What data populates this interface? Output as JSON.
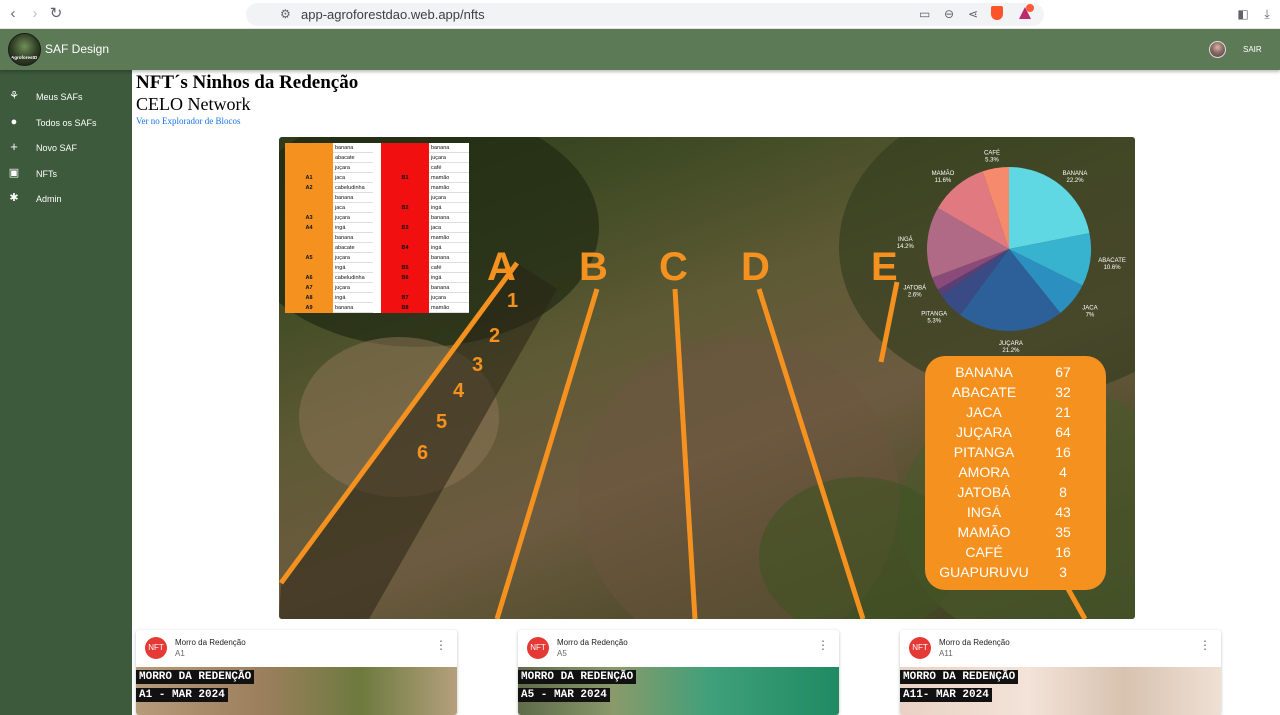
{
  "browser": {
    "url": "app-agroforestdao.web.app/nfts",
    "back_icon": "arrow-left-icon",
    "forward_icon": "arrow-right-icon",
    "reload_icon": "reload-icon"
  },
  "appbar": {
    "logo_text": "AgroforestDAO",
    "title": "SAF Design",
    "logout_label": "SAIR"
  },
  "sidebar": {
    "items": [
      {
        "label": "Meus SAFs",
        "icon": "seedling-icon"
      },
      {
        "label": "Todos os SAFs",
        "icon": "globe-icon"
      },
      {
        "label": "Novo SAF",
        "icon": "plus-icon"
      },
      {
        "label": "NFTs",
        "icon": "image-icon"
      },
      {
        "label": "Admin",
        "icon": "gear-icon"
      }
    ]
  },
  "main": {
    "title": "NFT´s Ninhos da Redenção",
    "subtitle": "CELO Network",
    "explorer_link": "Ver no Explorador de Blocos"
  },
  "hero": {
    "table_left": [
      {
        "id": "",
        "plant": "banana"
      },
      {
        "id": "",
        "plant": "abacate"
      },
      {
        "id": "",
        "plant": "juçara"
      },
      {
        "id": "A1",
        "plant": "jaca"
      },
      {
        "id": "A2",
        "plant": "cabeludinha"
      },
      {
        "id": "",
        "plant": "banana"
      },
      {
        "id": "",
        "plant": "jaca"
      },
      {
        "id": "A3",
        "plant": "juçara"
      },
      {
        "id": "A4",
        "plant": "ingá"
      },
      {
        "id": "",
        "plant": "banana"
      },
      {
        "id": "",
        "plant": "abacate"
      },
      {
        "id": "A5",
        "plant": "juçara"
      },
      {
        "id": "",
        "plant": "ingá"
      },
      {
        "id": "A6",
        "plant": "cabeludinha"
      },
      {
        "id": "A7",
        "plant": "juçara"
      },
      {
        "id": "A8",
        "plant": "ingá"
      },
      {
        "id": "A9",
        "plant": "banana"
      }
    ],
    "table_right": [
      {
        "id": "",
        "plant": "banana"
      },
      {
        "id": "",
        "plant": "juçara"
      },
      {
        "id": "",
        "plant": "café"
      },
      {
        "id": "B1",
        "plant": "mamão"
      },
      {
        "id": "",
        "plant": "mamão"
      },
      {
        "id": "",
        "plant": "juçara"
      },
      {
        "id": "B2",
        "plant": "ingá"
      },
      {
        "id": "",
        "plant": "banana"
      },
      {
        "id": "B3",
        "plant": "jaca"
      },
      {
        "id": "",
        "plant": "mamão"
      },
      {
        "id": "B4",
        "plant": "ingá"
      },
      {
        "id": "",
        "plant": "banana"
      },
      {
        "id": "B5",
        "plant": "café"
      },
      {
        "id": "B6",
        "plant": "ingá"
      },
      {
        "id": "",
        "plant": "banana"
      },
      {
        "id": "B7",
        "plant": "juçara"
      },
      {
        "id": "B8",
        "plant": "mamão"
      }
    ],
    "row_letters": [
      "A",
      "B",
      "C",
      "D",
      "E"
    ],
    "row_numbers": [
      "1",
      "2",
      "3",
      "4",
      "5",
      "6"
    ],
    "species_counts": [
      {
        "name": "BANANA",
        "count": "67"
      },
      {
        "name": "ABACATE",
        "count": "32"
      },
      {
        "name": "JACA",
        "count": "21"
      },
      {
        "name": "JUÇARA",
        "count": "64"
      },
      {
        "name": "PITANGA",
        "count": "16"
      },
      {
        "name": "AMORA",
        "count": "4"
      },
      {
        "name": "JATOBÁ",
        "count": "8"
      },
      {
        "name": "INGÁ",
        "count": "43"
      },
      {
        "name": "MAMÃO",
        "count": "35"
      },
      {
        "name": "CAFÉ",
        "count": "16"
      },
      {
        "name": "GUAPURUVU",
        "count": "3"
      }
    ],
    "pie": [
      {
        "label": "BANANA",
        "pct": "22.2%",
        "value": 22.2,
        "color": "#5fd8e3"
      },
      {
        "label": "ABACATE",
        "pct": "10.6%",
        "value": 10.6,
        "color": "#37b3d0"
      },
      {
        "label": "JACA",
        "pct": "7%",
        "value": 7.0,
        "color": "#2b8fbf"
      },
      {
        "label": "JUÇARA",
        "pct": "21.2%",
        "value": 21.2,
        "color": "#2d5f98"
      },
      {
        "label": "PITANGA",
        "pct": "5.3%",
        "value": 5.3,
        "color": "#3a4a84"
      },
      {
        "label": "",
        "pct": "",
        "value": 1.4,
        "color": "#5a3f74"
      },
      {
        "label": "JATOBÁ",
        "pct": "2.6%",
        "value": 2.6,
        "color": "#8a4a7a"
      },
      {
        "label": "INGÁ",
        "pct": "14.2%",
        "value": 14.2,
        "color": "#b06a86"
      },
      {
        "label": "MAMÃO",
        "pct": "11.6%",
        "value": 11.6,
        "color": "#e07a80"
      },
      {
        "label": "CAFÉ",
        "pct": "5.3%",
        "value": 5.3,
        "color": "#f58a6c"
      }
    ],
    "orange": "#f5911e",
    "red": "#f20f0f"
  },
  "cards": [
    {
      "avatar": "NFT",
      "title": "Morro da Redenção",
      "subtitle": "A1",
      "media_line1": "MORRO DA REDENÇÃO",
      "media_line2": "A1 - MAR 2024"
    },
    {
      "avatar": "NFT",
      "title": "Morro da Redenção",
      "subtitle": "A5",
      "media_line1": "MORRO DA REDENÇÃO",
      "media_line2": "A5 - MAR 2024"
    },
    {
      "avatar": "NFT",
      "title": "Morro da Redenção",
      "subtitle": "A11",
      "media_line1": "MORRO DA REDENÇÃO",
      "media_line2": "A11- MAR 2024"
    }
  ]
}
